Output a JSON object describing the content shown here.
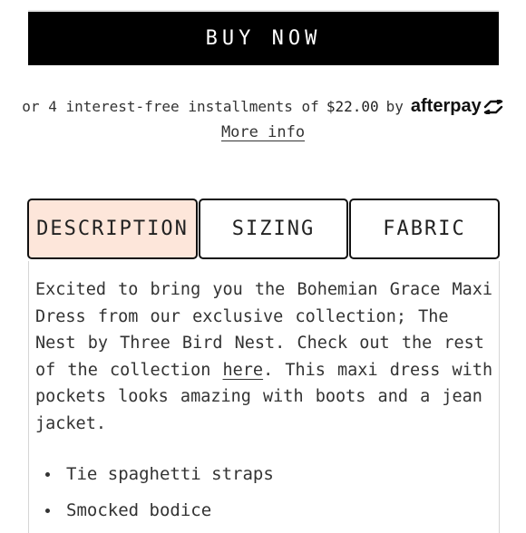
{
  "buy_button": {
    "label": "BUY NOW"
  },
  "afterpay": {
    "prefix": "or 4 interest-free installments of",
    "amount": "$22.00",
    "by": "by",
    "brand": "afterpay",
    "more_info": "More info"
  },
  "tabs": [
    {
      "label": "DESCRIPTION",
      "active": true
    },
    {
      "label": "SIZING",
      "active": false
    },
    {
      "label": "FABRIC",
      "active": false
    }
  ],
  "description": {
    "text_before_link": "Excited to bring you the Bohemian Grace Maxi Dress from our exclusive collection; The Nest by Three Bird Nest. Check out the rest of the collection",
    "link_text": "here",
    "text_after_link": ". This maxi dress with pockets looks amazing with boots and a jean jacket.",
    "bullets": [
      "Tie spaghetti straps",
      "Smocked bodice"
    ]
  },
  "colors": {
    "button_bg": "#000000",
    "active_tab_bg": "#fde6da"
  }
}
